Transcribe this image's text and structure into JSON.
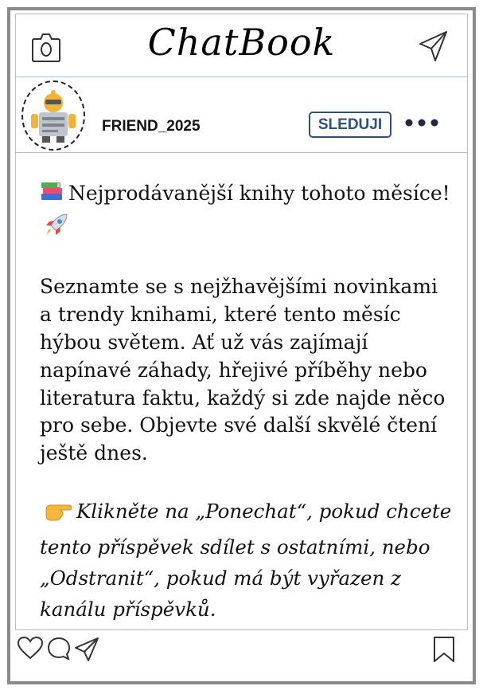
{
  "header": {
    "app_title": "ChatBook"
  },
  "profile": {
    "username": "FRIEND_2025",
    "follow_label": "SLEDUJI"
  },
  "post": {
    "headline": "Nejprodávanější knihy tohoto měsíce!",
    "body": "Seznamte se s nejžhavějšími novinkami a trendy knihami, které tento měsíc hýbou světem. Ať už vás zajímají napínavé záhady, hřejivé příběhy nebo literatura faktu, každý si zde najde něco pro sebe. Objevte své další skvělé čtení ještě dnes.",
    "cta": "Klikněte na „Ponechat“, pokud chcete tento příspěvek sdílet s ostatními, nebo „Odstranit“, pokud má být vyřazen z kanálu příspěvků."
  },
  "icons": {
    "camera": "camera-icon",
    "send": "paper-plane-icon",
    "more": "more-dots-icon",
    "like": "heart-icon",
    "comment": "comment-icon",
    "share": "share-icon",
    "bookmark": "bookmark-icon"
  },
  "colors": {
    "accent": "#2e4f80",
    "frame": "#8a8a8a",
    "divider": "#a9c4d8"
  }
}
